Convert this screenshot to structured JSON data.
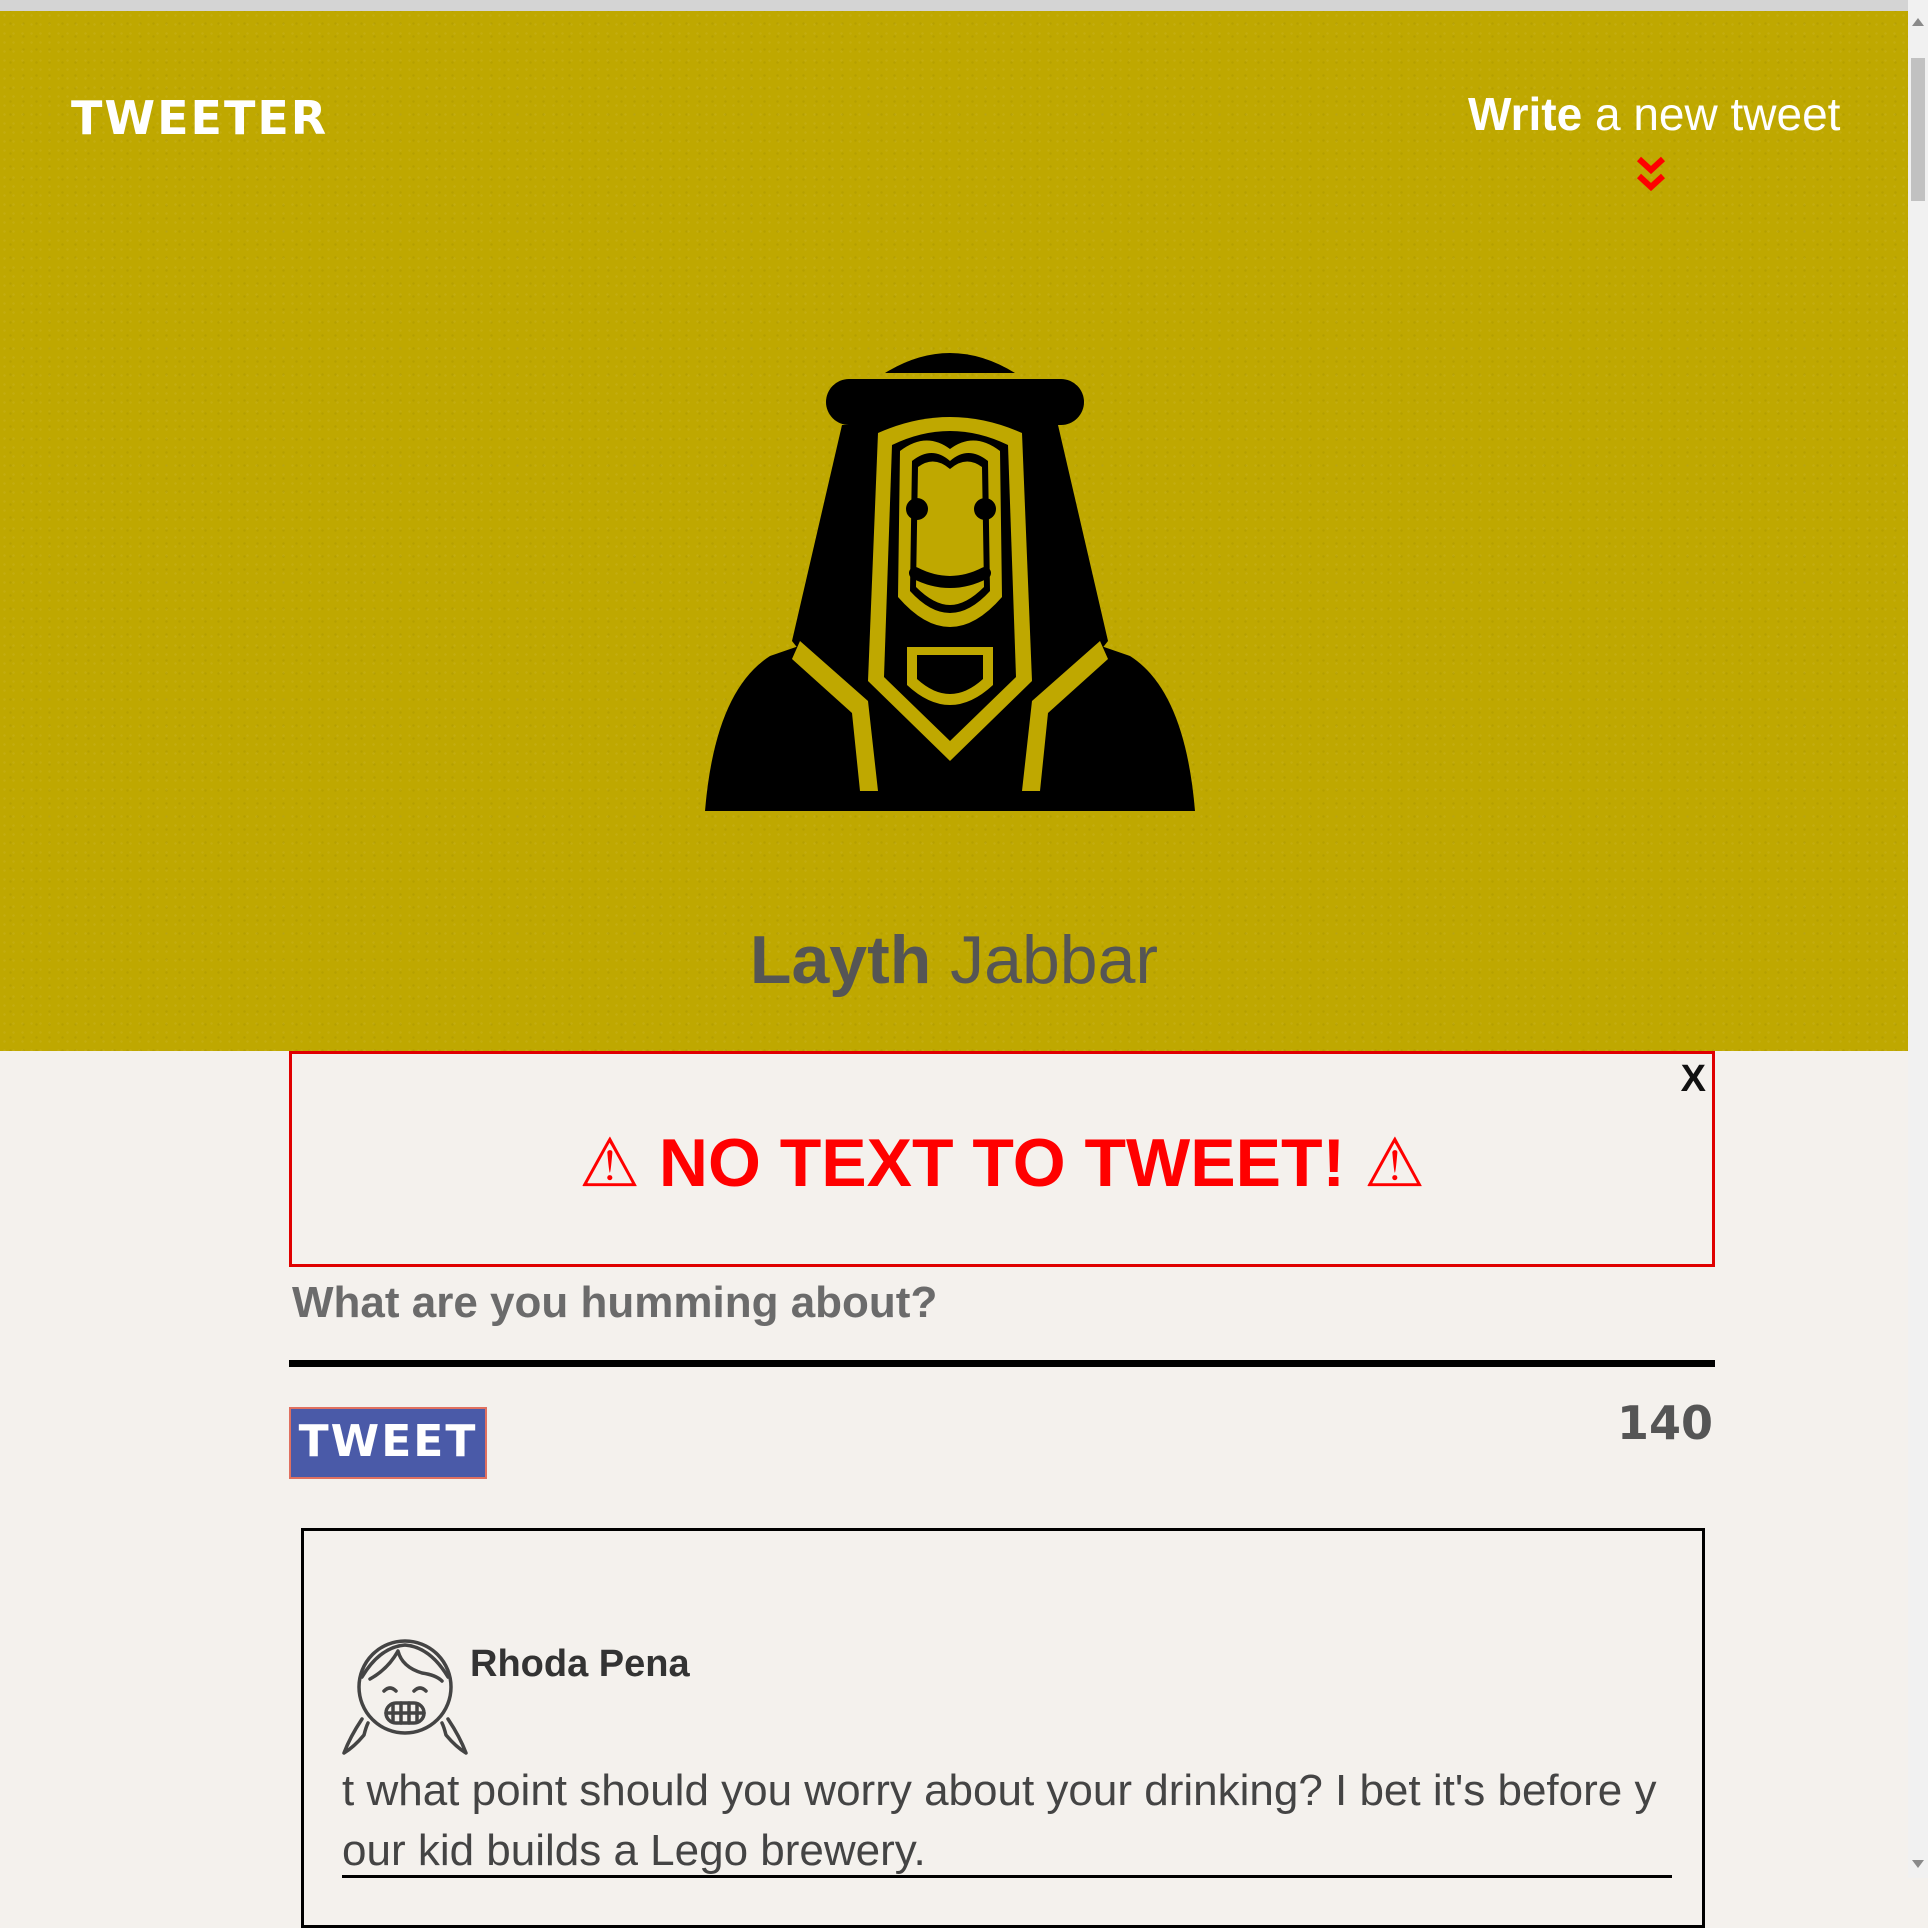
{
  "app": {
    "logo": "TWEETER"
  },
  "nav": {
    "write_bold": "Write",
    "write_rest": " a new tweet",
    "arrow_icon": "double-chevron-down-icon",
    "arrow_color": "#ff0000"
  },
  "profile": {
    "first_name": "Layth",
    "last_name": " Jabbar",
    "avatar_icon": "arab-man-avatar-icon",
    "header_color": "#bfa800"
  },
  "alert": {
    "close_label": "X",
    "message": "⚠ NO TEXT TO TWEET! ⚠",
    "color": "#ff0000"
  },
  "compose": {
    "placeholder": "What are you humming about?",
    "button_label": "TWEET",
    "char_count": "140",
    "button_color": "#4a5aa8"
  },
  "tweets": [
    {
      "author": "Rhoda Pena",
      "avatar_icon": "girl-avatar-icon",
      "text": "t what point should you worry about your drinking? I bet it's before your kid builds a Lego brewery."
    }
  ]
}
